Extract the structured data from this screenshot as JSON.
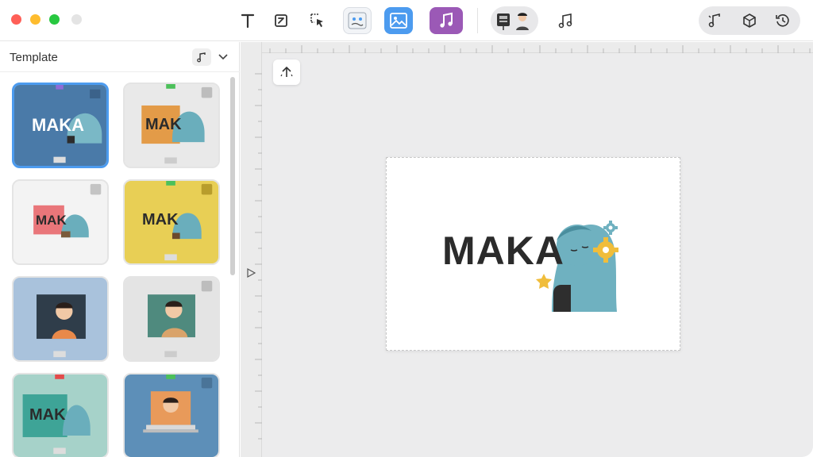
{
  "sidebar": {
    "title": "Template"
  },
  "artboard": {
    "logo_text": "MAKA"
  },
  "thumbnails": [
    {
      "label": "MAKA",
      "bg": "#4a7aa8"
    },
    {
      "label": "MAK",
      "bg": "#e9e9e9"
    },
    {
      "label": "MAK",
      "bg": "#f3f3f3"
    },
    {
      "label": "MAK",
      "bg": "#e8cf55"
    },
    {
      "label": "",
      "bg": "#a9c2dc"
    },
    {
      "label": "",
      "bg": "#e4e4e4"
    },
    {
      "label": "MAK",
      "bg": "#a6d2c9"
    },
    {
      "label": "",
      "bg": "#5d8fb8"
    }
  ],
  "colors": {
    "accent_blue": "#4c9bef",
    "accent_purple": "#9b59b6",
    "traffic_red": "#ff5f57",
    "traffic_yellow": "#febc2e",
    "traffic_green": "#28c840"
  },
  "icons": {
    "text_tool": "text-icon",
    "edit_tool": "edit-icon",
    "select_tool": "select-cursor-icon",
    "sticker_tool": "sticker-icon",
    "image_tool": "image-icon",
    "music_tool": "music-icon",
    "avatar_tool": "avatar-icon",
    "audio_tool": "audio-note-icon",
    "right_music": "music-note-icon",
    "right_cube": "cube-icon",
    "right_history": "history-icon",
    "upload": "upload-icon"
  }
}
